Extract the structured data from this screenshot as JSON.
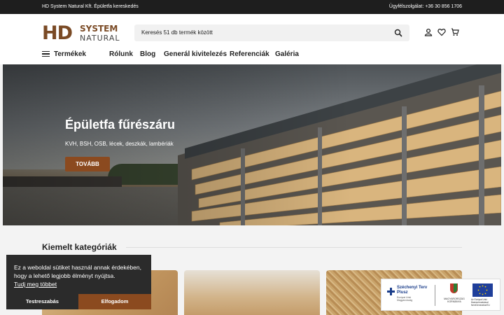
{
  "topbar": {
    "left_text": "HD System Natural Kft. Épületfa kereskedés",
    "right_text": "Ügyfélszolgálat: +36 30 856 1706"
  },
  "logo": {
    "mark": "HD",
    "line1": "SYSTEM",
    "line2": "NATURAL"
  },
  "search": {
    "placeholder": "Keresés 51 db termék között"
  },
  "header_icons": [
    "user-icon",
    "heart-icon",
    "cart-icon"
  ],
  "nav": {
    "products_label": "Termékek",
    "items": [
      {
        "label": "Rólunk"
      },
      {
        "label": "Blog"
      },
      {
        "label": "Generál kivitelezés"
      },
      {
        "label": "Referenciák"
      },
      {
        "label": "Galéria"
      }
    ]
  },
  "hero": {
    "title": "Épületfa fűrészáru",
    "subtitle": "KVH, BSH, OSB, lécek, deszkák, lambériák",
    "button_label": "TOVÁBB"
  },
  "featured": {
    "title": "Kiemelt kategóriák"
  },
  "cookie": {
    "message": "Ez a weboldal sütiket használ annak érdekében, hogy a lehető legjobb élményt nyújtsa.",
    "link_label": "Tudj meg többet",
    "settings_label": "Testreszabás",
    "accept_label": "Elfogadom"
  },
  "funding": {
    "szechenyi_line1": "Széchenyi Terv",
    "szechenyi_line2": "Plusz",
    "szechenyi_small": "Európai Unió Magyarország",
    "hu_text": "MAGYARORSZÁG KORMÁNYA",
    "eu_text": "Az Európai Unió finanszírozásával NextGenerationEU"
  },
  "colors": {
    "accent": "#8b4a1f",
    "brand_brown": "#7a4a25",
    "topbar": "#1e1e1e"
  }
}
